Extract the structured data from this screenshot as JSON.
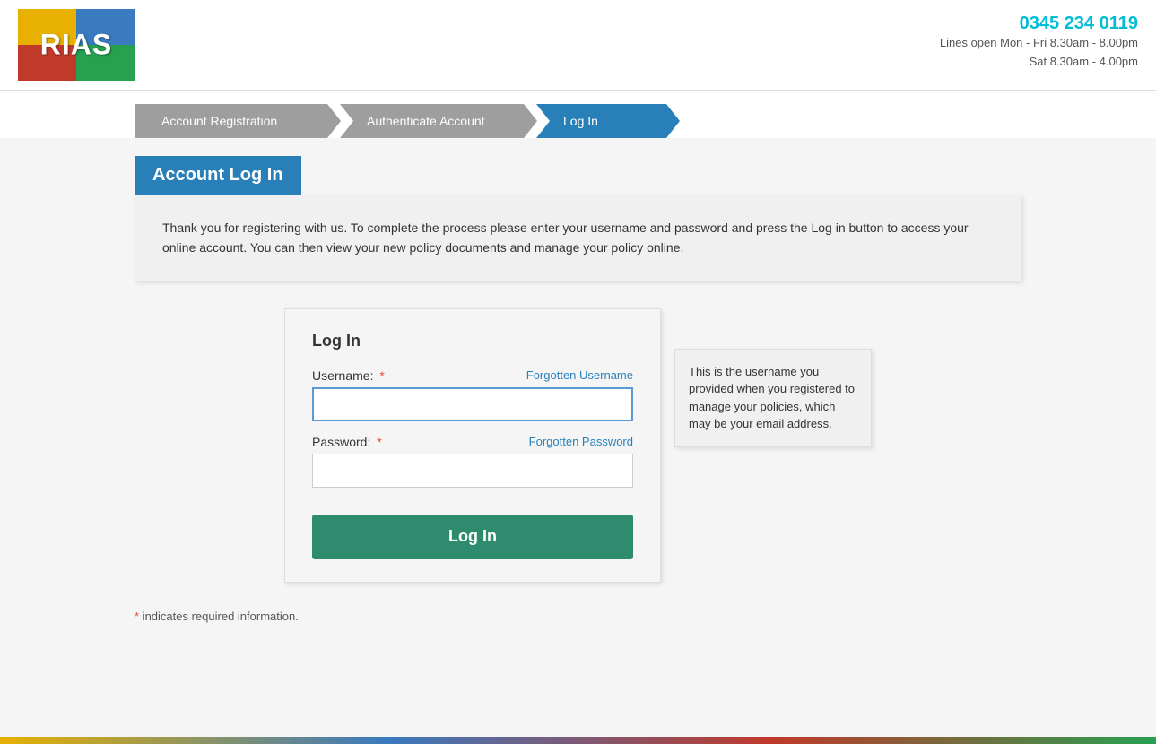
{
  "header": {
    "logo_text": "RIAS",
    "phone": "0345 234 0119",
    "hours_line1": "Lines open Mon - Fri 8.30am - 8.00pm",
    "hours_line2": "Sat 8.30am - 4.00pm"
  },
  "steps": [
    {
      "label": "Account Registration",
      "state": "inactive"
    },
    {
      "label": "Authenticate Account",
      "state": "inactive"
    },
    {
      "label": "Log In",
      "state": "active"
    }
  ],
  "section": {
    "title": "Account Log In",
    "description": "Thank you for registering with us. To complete the process please enter your username and password and press the Log in button to access your online account. You can then view your new policy documents and manage your policy online."
  },
  "form": {
    "title": "Log In",
    "username_label": "Username:",
    "username_placeholder": "",
    "forgotten_username": "Forgotten Username",
    "password_label": "Password:",
    "password_placeholder": "",
    "forgotten_password": "Forgotten Password",
    "login_button": "Log In"
  },
  "tooltip": {
    "text": "This is the username you provided when you registered to manage your policies, which may be your email address."
  },
  "footer": {
    "required_note": "* indicates required information."
  }
}
